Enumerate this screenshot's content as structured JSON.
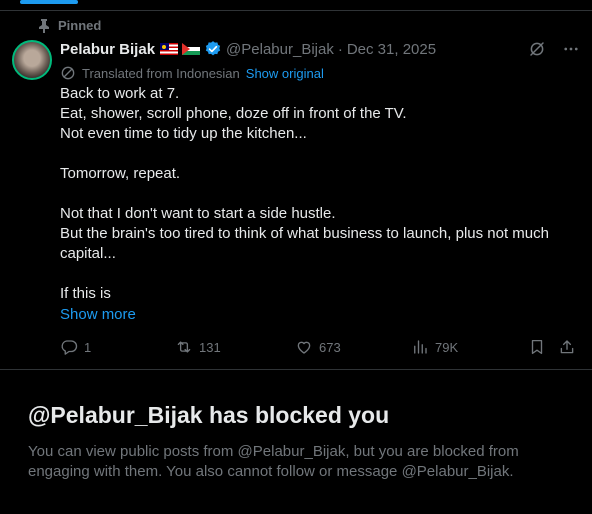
{
  "pinned": {
    "label": "Pinned"
  },
  "author": {
    "display_name": "Pelabur Bijak",
    "handle": "@Pelabur_Bijak",
    "separator": "·",
    "date": "Dec 31, 2025"
  },
  "translation": {
    "text": "Translated from Indonesian",
    "show_original": "Show original"
  },
  "post": {
    "lines": [
      "Back to work at 7.",
      "Eat, shower, scroll phone, doze off in front of the TV.",
      "Not even time to tidy up the kitchen...",
      "",
      "Tomorrow, repeat.",
      "",
      "Not that I don't want to start a side hustle.",
      "But the brain's too tired to think of what business to launch, plus not much capital...",
      "",
      "If this is"
    ],
    "show_more": "Show more"
  },
  "metrics": {
    "replies": "1",
    "reposts": "131",
    "likes": "673",
    "views": "79K"
  },
  "blocked": {
    "title": "@Pelabur_Bijak has blocked you",
    "description": "You can view public posts from @Pelabur_Bijak, but you are blocked from engaging with them. You also cannot follow or message @Pelabur_Bijak."
  },
  "colors": {
    "accent": "#1d9bf0",
    "muted": "#71767b",
    "text": "#e7e9ea",
    "avatar_ring": "#00ba7c",
    "background": "#000000"
  },
  "icons": [
    "pin-icon",
    "verified-icon",
    "grok-icon",
    "more-icon",
    "translate-icon",
    "reply-icon",
    "repost-icon",
    "like-icon",
    "views-icon",
    "bookmark-icon",
    "share-icon"
  ]
}
